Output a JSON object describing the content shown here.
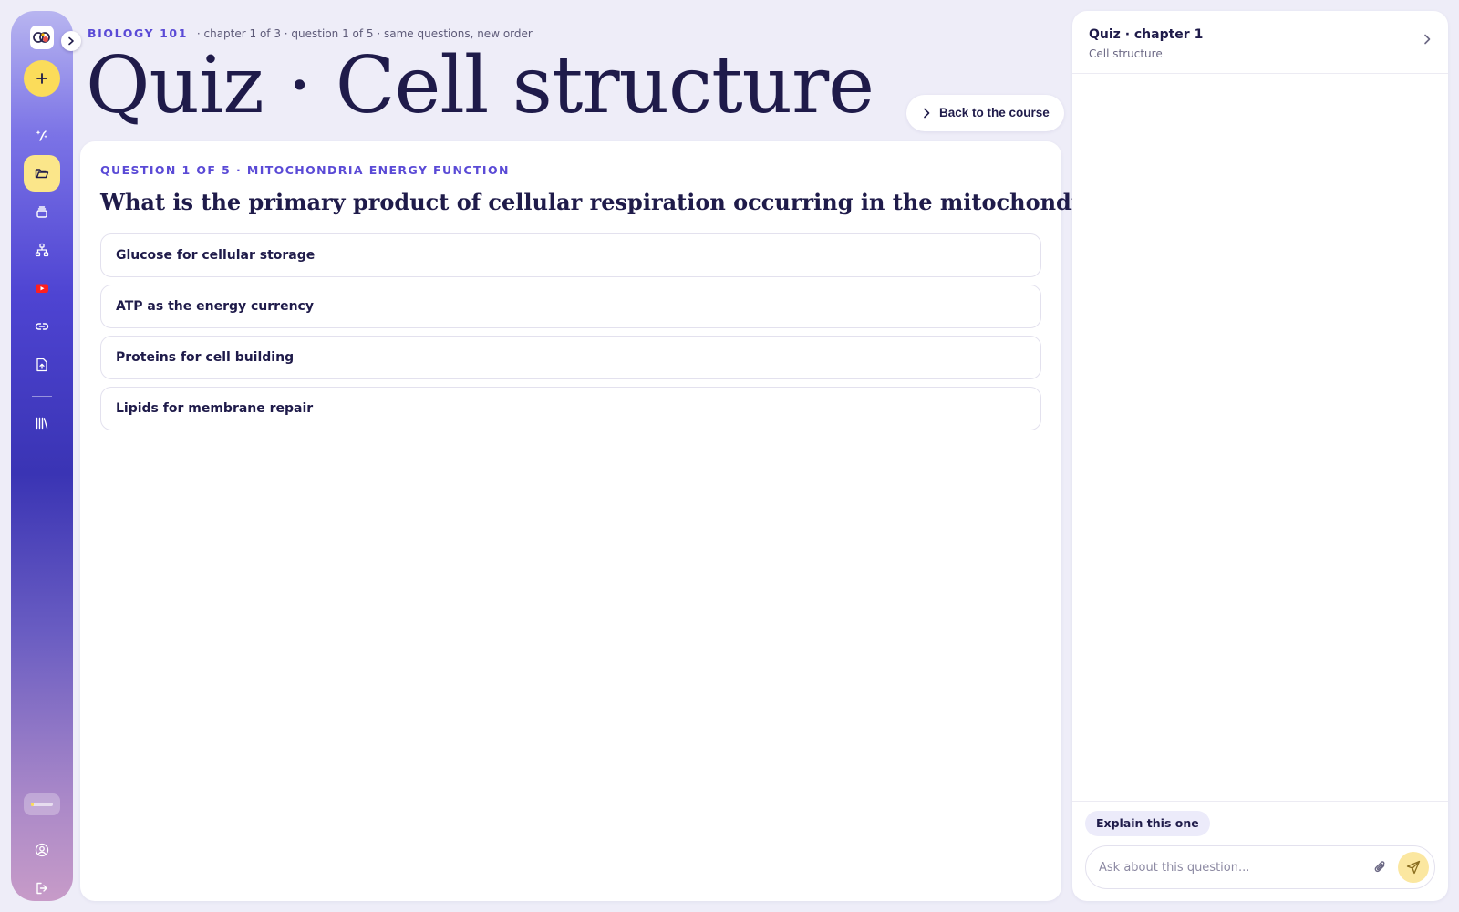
{
  "header": {
    "course": "BIOLOGY 101",
    "context": "· chapter 1 of 3 · question 1 of 5 · same questions, new order",
    "title": "Quiz · Cell structure",
    "back_label": "Back to the course"
  },
  "question": {
    "label": "QUESTION 1 OF 5 · MITOCHONDRIA ENERGY FUNCTION",
    "text": "What is the primary product of cellular respiration occurring in the mitochondria?",
    "options": [
      "Glucose for cellular storage",
      "ATP as the energy currency",
      "Proteins for cell building",
      "Lipids for membrane repair"
    ]
  },
  "panel": {
    "title": "Quiz · chapter 1",
    "subtitle": "Cell structure",
    "explain_label": "Explain this one",
    "ask_placeholder": "Ask about this question..."
  },
  "sidebar": {
    "progress_fraction": 0.12,
    "icons": [
      "sparkles-icon",
      "folder-icon",
      "stack-icon",
      "sitemap-icon",
      "youtube-icon",
      "link-icon",
      "file-upload-icon",
      "library-icon",
      "user-circle-icon",
      "logout-icon"
    ]
  },
  "colors": {
    "accent": "#5a4ad6",
    "yellow": "#fbdc5a",
    "text": "#1f1b4a",
    "page_bg": "#eeedf8"
  }
}
